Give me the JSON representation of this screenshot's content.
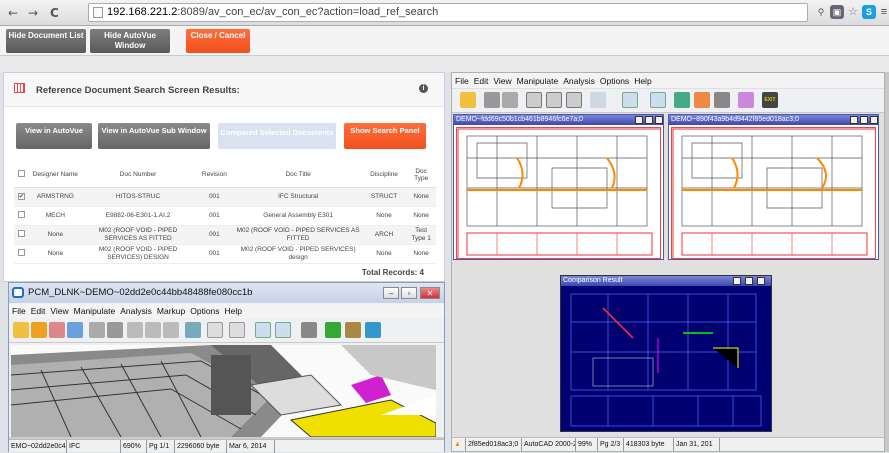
{
  "browser": {
    "url_host": "192.168.221.2",
    "url_path": ":8089/av_con_ec/av_con_ec?action=load_ref_search",
    "back": "←",
    "forward": "→",
    "reload": "C"
  },
  "toolbar": {
    "hide_doc": "Hide Document List",
    "hide_av": "Hide AutoVue Window",
    "close": "Close / Cancel"
  },
  "results": {
    "title": "Reference Document Search Screen Results:",
    "buttons": {
      "view_av": "View in AutoVue",
      "view_sub": "View in AutoVue Sub Window",
      "compare": "Compared Selected Documents",
      "show_panel": "Show Search Panel"
    },
    "columns": [
      "Designer Name",
      "Doc Number",
      "Revision",
      "Doc Title",
      "Discipline",
      "Doc Type"
    ],
    "rows": [
      {
        "checked": true,
        "designer": "ARMSTRNG",
        "number": "HITOS-STRUC",
        "revision": "001",
        "title": "IFC Structural",
        "discipline": "STRUCT",
        "type": "None"
      },
      {
        "checked": false,
        "designer": "MECH",
        "number": "E9882-06-E301-1.AI.2",
        "revision": "001",
        "title": "General Assembly E301",
        "discipline": "None",
        "type": "None"
      },
      {
        "checked": false,
        "designer": "None",
        "number": "M02 (ROOF VOID - PIPED SERVICES AS FITTED",
        "revision": "001",
        "title": "M02 (ROOF VOID - PIPED SERVICES AS FITTED",
        "discipline": "ARCH",
        "type": "Test Type 1"
      },
      {
        "checked": false,
        "designer": "None",
        "number": "M02 (ROOF VOID - PIPED SERVICES) DESIGN",
        "revision": "001",
        "title": "M02 (ROOF VOID - PIPED SERVICES) design",
        "discipline": "None",
        "type": "None"
      }
    ],
    "total": "Total Records: 4"
  },
  "left_win": {
    "title": "PCM_DLNK~DEMO~02dd2e0c44bb48488fe080cc1b",
    "menu": [
      "File",
      "Edit",
      "View",
      "Manipulate",
      "Analysis",
      "Markup",
      "Options",
      "Help"
    ],
    "status": [
      "EMO~02dd2e0c44",
      "IFC",
      "690%",
      "Pg 1/1",
      "2296060 byte",
      "Mar 6, 2014"
    ]
  },
  "right_win": {
    "menu": [
      "File",
      "Edit",
      "View",
      "Manipulate",
      "Analysis",
      "Options",
      "Help"
    ],
    "doc1": "DEMO~fdd69c50b1cb461b8946fc6e7a;0",
    "doc2": "DEMO~890f43a9b4d9442f85ed018ac3;0",
    "compare_title": "Comparison Result",
    "status": [
      "2f85ed018ac3;0",
      "AutoCAD 2000-2",
      "99%",
      "Pg 2/3",
      "418303 byte",
      "Jan 31, 201"
    ]
  },
  "colors": {
    "accent": "#f0501e",
    "gray_btn": "#666666",
    "doc_title_bar": "#3c48a8",
    "cad_bg": "#000080"
  }
}
